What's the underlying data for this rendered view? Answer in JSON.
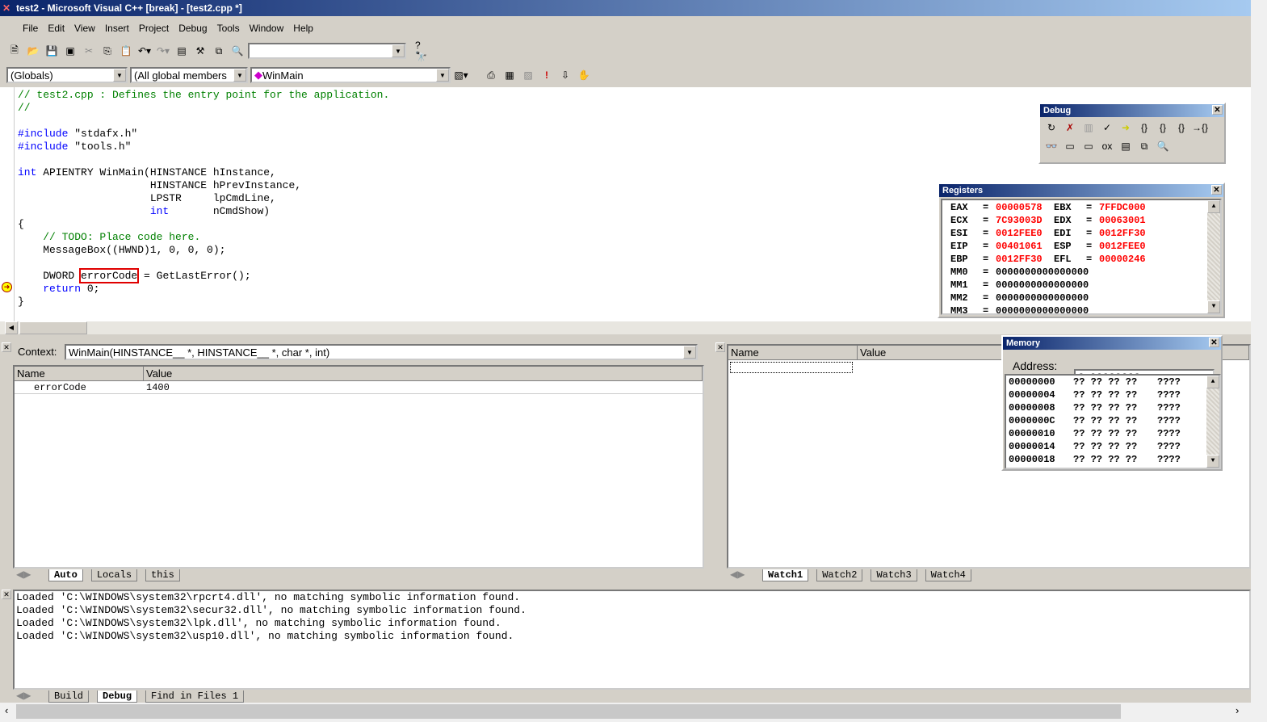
{
  "window": {
    "title": "test2 - Microsoft Visual C++ [break] - [test2.cpp *]"
  },
  "menu": [
    "File",
    "Edit",
    "View",
    "Insert",
    "Project",
    "Debug",
    "Tools",
    "Window",
    "Help"
  ],
  "toolbar": {
    "find_combo": "",
    "scope_combo": "(Globals)",
    "members_combo": "(All global members",
    "function_combo": "WinMain"
  },
  "code": [
    [
      [
        "// test2.cpp : Defines the entry point for the application.",
        "comment"
      ]
    ],
    [
      [
        "//",
        "comment"
      ]
    ],
    [],
    [
      [
        "#include",
        "kw"
      ],
      [
        " \"stdafx.h\"",
        ""
      ]
    ],
    [
      [
        "#include",
        "kw"
      ],
      [
        " \"tools.h\"",
        ""
      ]
    ],
    [],
    [
      [
        "int",
        "kw"
      ],
      [
        " APIENTRY WinMain(HINSTANCE hInstance,",
        ""
      ]
    ],
    [
      [
        "                     HINSTANCE hPrevInstance,",
        ""
      ]
    ],
    [
      [
        "                     LPSTR     lpCmdLine,",
        ""
      ]
    ],
    [
      [
        "                     ",
        ""
      ],
      [
        "int",
        "kw"
      ],
      [
        "       nCmdShow)",
        ""
      ]
    ],
    [
      [
        "{",
        ""
      ]
    ],
    [
      [
        "    ",
        ""
      ],
      [
        "// TODO: Place code here.",
        "comment"
      ]
    ],
    [
      [
        "    MessageBox((HWND)1, 0, 0, 0);",
        ""
      ]
    ],
    [],
    [
      [
        "    DWORD ",
        ""
      ],
      [
        "errorCode",
        "hl"
      ],
      [
        " = GetLastError();",
        ""
      ]
    ],
    [
      [
        "    ",
        ""
      ],
      [
        "return",
        "kw"
      ],
      [
        " 0;",
        ""
      ]
    ],
    [
      [
        "}",
        ""
      ]
    ]
  ],
  "debug_toolbar": {
    "title": "Debug"
  },
  "registers": {
    "title": "Registers",
    "rows": [
      [
        "EAX",
        "00000578",
        "EBX",
        "7FFDC000"
      ],
      [
        "ECX",
        "7C93003D",
        "EDX",
        "00063001"
      ],
      [
        "ESI",
        "0012FEE0",
        "EDI",
        "0012FF30"
      ],
      [
        "EIP",
        "00401061",
        "ESP",
        "0012FEE0"
      ],
      [
        "EBP",
        "0012FF30",
        "EFL",
        "00000246"
      ],
      [
        "MM0",
        "0000000000000000"
      ],
      [
        "MM1",
        "0000000000000000"
      ],
      [
        "MM2",
        "0000000000000000"
      ],
      [
        "MM3",
        "0000000000000000"
      ]
    ]
  },
  "variables": {
    "context_label": "Context:",
    "context_value": "WinMain(HINSTANCE__ *, HINSTANCE__ *, char *, int)",
    "columns": [
      "Name",
      "Value"
    ],
    "rows": [
      [
        "errorCode",
        "1400"
      ]
    ],
    "tabs": [
      "Auto",
      "Locals",
      "this"
    ],
    "active_tab": "Auto"
  },
  "watch": {
    "columns": [
      "Name",
      "Value"
    ],
    "tabs": [
      "Watch1",
      "Watch2",
      "Watch3",
      "Watch4"
    ],
    "active_tab": "Watch1"
  },
  "memory": {
    "title": "Memory",
    "address_label": "Address:",
    "address_value": "0x00000000",
    "rows": [
      [
        "00000000",
        "?? ?? ?? ??",
        "????"
      ],
      [
        "00000004",
        "?? ?? ?? ??",
        "????"
      ],
      [
        "00000008",
        "?? ?? ?? ??",
        "????"
      ],
      [
        "0000000C",
        "?? ?? ?? ??",
        "????"
      ],
      [
        "00000010",
        "?? ?? ?? ??",
        "????"
      ],
      [
        "00000014",
        "?? ?? ?? ??",
        "????"
      ],
      [
        "00000018",
        "?? ?? ?? ??",
        "????"
      ]
    ]
  },
  "output": {
    "lines": [
      "Loaded 'C:\\WINDOWS\\system32\\rpcrt4.dll', no matching symbolic information found.",
      "Loaded 'C:\\WINDOWS\\system32\\secur32.dll', no matching symbolic information found.",
      "Loaded 'C:\\WINDOWS\\system32\\lpk.dll', no matching symbolic information found.",
      "Loaded 'C:\\WINDOWS\\system32\\usp10.dll', no matching symbolic information found."
    ],
    "tabs": [
      "Build",
      "Debug",
      "Find in Files 1"
    ],
    "active_tab": "Debug"
  },
  "colors": {
    "register_changed": "#ff0000",
    "keyword": "#0000ff",
    "comment": "#008000",
    "highlight_box": "#e00000",
    "title_start": "#0a246a",
    "title_end": "#a6caf0"
  }
}
